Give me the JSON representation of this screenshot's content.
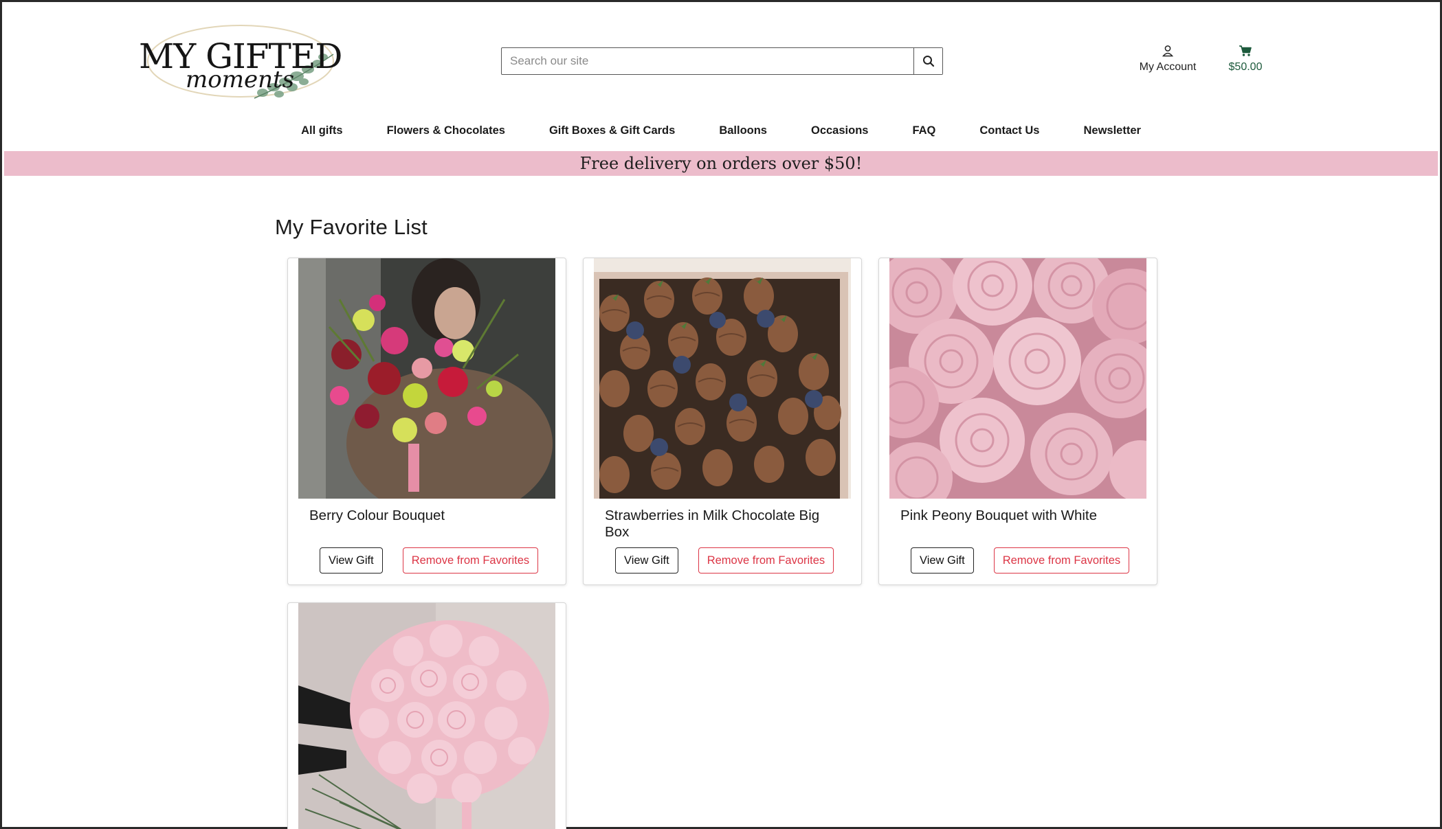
{
  "brand": {
    "logo_text_main": "MY GIFTED",
    "logo_text_script": "moments"
  },
  "search": {
    "placeholder": "Search our site",
    "icon": "search-icon"
  },
  "account": {
    "label": "My Account",
    "icon": "user-icon"
  },
  "cart": {
    "total": "$50.00",
    "icon": "cart-icon",
    "color": "#1d5a3c"
  },
  "nav": {
    "items": [
      {
        "label": "All gifts"
      },
      {
        "label": "Flowers & Chocolates"
      },
      {
        "label": "Gift Boxes & Gift Cards"
      },
      {
        "label": "Balloons"
      },
      {
        "label": "Occasions"
      },
      {
        "label": "FAQ"
      },
      {
        "label": "Contact Us"
      },
      {
        "label": "Newsletter"
      }
    ]
  },
  "promo": {
    "text": "Free delivery on orders over $50!",
    "background": "#ecbccb"
  },
  "main": {
    "title": "My Favorite List",
    "cards": [
      {
        "name": "Berry Colour Bouquet",
        "view_label": "View Gift",
        "remove_label": "Remove from Favorites"
      },
      {
        "name": "Strawberries in Milk Chocolate Big Box",
        "view_label": "View Gift",
        "remove_label": "Remove from Favorites"
      },
      {
        "name": "Pink Peony Bouquet with White",
        "view_label": "View Gift",
        "remove_label": "Remove from Favorites"
      },
      {
        "name": "",
        "view_label": "",
        "remove_label": ""
      }
    ]
  },
  "colors": {
    "remove_red": "#dc3545",
    "accent_green": "#1d5a3c"
  }
}
